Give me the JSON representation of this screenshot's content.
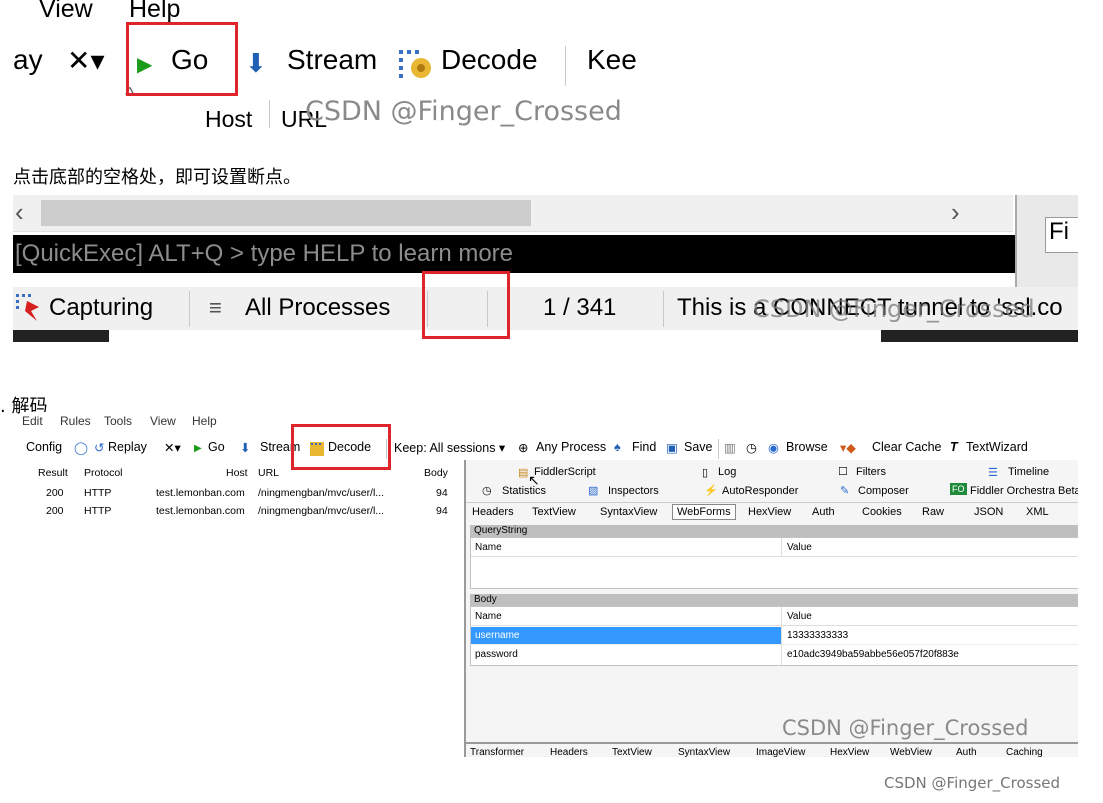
{
  "section1": {
    "menu": [
      "View",
      "Help"
    ],
    "toolbar": {
      "replay_partial": "ay",
      "remove": "✕▾",
      "go": "Go",
      "stream": "Stream",
      "decode": "Decode",
      "keep_partial": "Kee"
    },
    "columns": {
      "host": "Host",
      "url": "URL"
    },
    "watermark": "CSDN @Finger_Crossed"
  },
  "caption1": "点击底部的空格处，即可设置断点。",
  "section2": {
    "quickexec": "[QuickExec] ALT+Q > type HELP to learn more",
    "side_partial": "Fi",
    "status": {
      "capturing": "Capturing",
      "processes": "All Processes",
      "count": "1 / 341",
      "message": "This is a CONNECT tunnel to 'ssl.co"
    },
    "watermark": "CSDN @Finger_Crossed"
  },
  "caption2": ". 解码",
  "fiddler": {
    "menu": [
      "Edit",
      "Rules",
      "Tools",
      "View",
      "Help"
    ],
    "toolbar": {
      "config": "Config",
      "replay": "Replay",
      "remove": "✕▾",
      "go": "Go",
      "stream": "Stream",
      "decode": "Decode",
      "keep": "Keep: All sessions ▾",
      "process": "Any Process",
      "find": "Find",
      "save": "Save",
      "browse": "Browse",
      "clear_cache": "Clear Cache",
      "textwizard": "TextWizard"
    },
    "session_columns": [
      "Result",
      "Protocol",
      "Host",
      "URL",
      "Body"
    ],
    "sessions": [
      {
        "result": "200",
        "protocol": "HTTP",
        "host": "test.lemonban.com",
        "url": "/ningmengban/mvc/user/l...",
        "body": "94"
      },
      {
        "result": "200",
        "protocol": "HTTP",
        "host": "test.lemonban.com",
        "url": "/ningmengban/mvc/user/l...",
        "body": "94"
      }
    ],
    "tabs_row1": [
      "FiddlerScript",
      "Log",
      "Filters",
      "Timeline"
    ],
    "tabs_row2": [
      "Statistics",
      "Inspectors",
      "AutoResponder",
      "Composer",
      "Fiddler Orchestra Beta"
    ],
    "inspector_tabs": [
      "Headers",
      "TextView",
      "SyntaxView",
      "WebForms",
      "HexView",
      "Auth",
      "Cookies",
      "Raw",
      "JSON",
      "XML"
    ],
    "querystring": {
      "title": "QueryString",
      "name_col": "Name",
      "value_col": "Value"
    },
    "body": {
      "title": "Body",
      "name_col": "Name",
      "value_col": "Value",
      "rows": [
        {
          "name": "username",
          "value": "13333333333"
        },
        {
          "name": "password",
          "value": "e10adc3949ba59abbe56e057f20f883e"
        }
      ]
    },
    "response_tabs": [
      "Transformer",
      "Headers",
      "TextView",
      "SyntaxView",
      "ImageView",
      "HexView",
      "WebView",
      "Auth",
      "Caching"
    ],
    "watermark": "CSDN @Finger_Crossed"
  },
  "page_watermark": "CSDN @Finger_Crossed",
  "colors": {
    "highlight": "#e0242b",
    "selection": "#3399ff"
  }
}
